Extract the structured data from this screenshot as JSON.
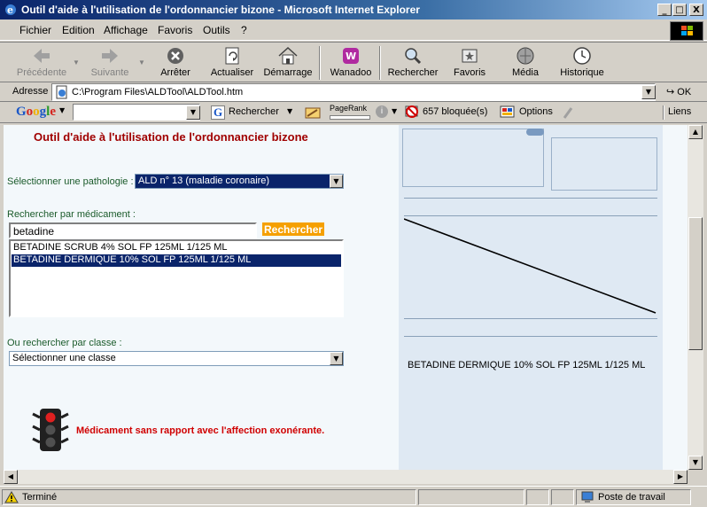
{
  "window": {
    "title": "Outil d'aide à l'utilisation de l'ordonnancier bizone - Microsoft Internet Explorer",
    "minimize": "_",
    "maximize": "□",
    "close": "X"
  },
  "menu": [
    "Fichier",
    "Edition",
    "Affichage",
    "Favoris",
    "Outils",
    "?"
  ],
  "toolbar": {
    "back": "Précédente",
    "forward": "Suivante",
    "stop": "Arrêter",
    "refresh": "Actualiser",
    "home": "Démarrage",
    "wanadoo": "Wanadoo",
    "search": "Rechercher",
    "favorites": "Favoris",
    "media": "Média",
    "history": "Historique"
  },
  "address": {
    "label": "Adresse",
    "value": "C:\\Program Files\\ALDTool\\ALDTool.htm",
    "go": "OK"
  },
  "google_bar": {
    "logo": "Google",
    "search_label": "Rechercher",
    "pagerank": "PageRank",
    "blocked": "657 bloquée(s)",
    "options": "Options",
    "links": "Liens"
  },
  "page": {
    "title": "Outil d'aide à l'utilisation de l'ordonnancier bizone",
    "pathology_label": "Sélectionner une pathologie :",
    "pathology_value": "ALD n° 13 (maladie coronaire)",
    "drug_search_label": "Rechercher par médicament :",
    "drug_search_value": "betadine",
    "search_button": "Rechercher",
    "results": [
      {
        "label": "BETADINE SCRUB 4% SOL FP 125ML 1/125 ML",
        "selected": false
      },
      {
        "label": "BETADINE DERMIQUE 10% SOL FP 125ML 1/125 ML",
        "selected": true
      }
    ],
    "class_label": "Ou rechercher par classe :",
    "class_value": "Sélectionner une classe",
    "status_message": "Médicament sans rapport avec l'affection exonérante.",
    "prescription_drug": "BETADINE DERMIQUE 10% SOL FP 125ML 1/125 ML"
  },
  "statusbar": {
    "state": "Terminé",
    "zone": "Poste de travail"
  },
  "colors": {
    "title_red": "#a00000",
    "label_green": "#1a5a2a",
    "search_button_orange": "#f5a000",
    "selection_blue": "#0a246a",
    "status_red": "#d00000"
  }
}
